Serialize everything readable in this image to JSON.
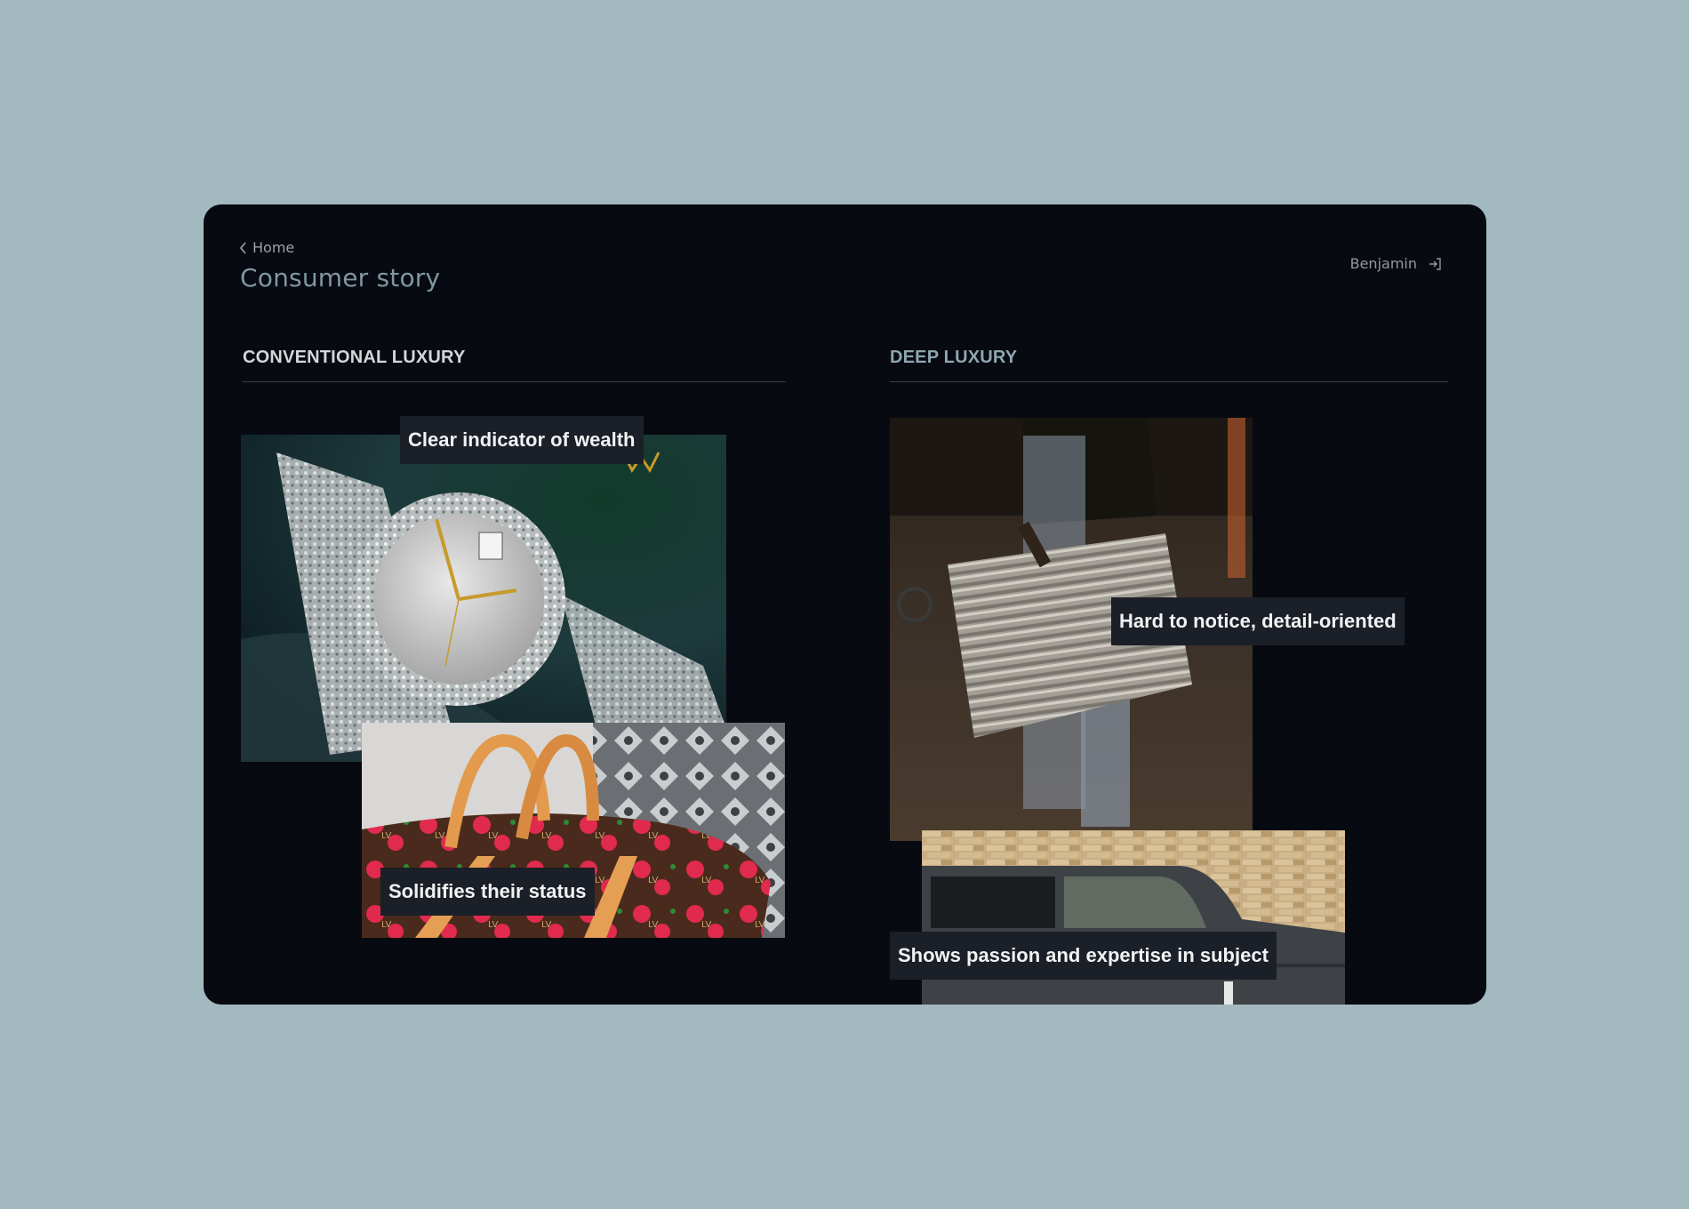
{
  "nav": {
    "back_label": "Home"
  },
  "page": {
    "title": "Consumer story"
  },
  "user": {
    "name": "Benjamin"
  },
  "sections": [
    {
      "heading": "CONVENTIONAL LUXURY",
      "cards": [
        {
          "image": "diamond-watch-photo",
          "caption": "Clear indicator of wealth"
        },
        {
          "image": "monogram-bag-photo",
          "caption": "Solidifies their status"
        }
      ]
    },
    {
      "heading": "DEEP LUXURY",
      "cards": [
        {
          "image": "aluminium-suitcase-photo",
          "caption": "Hard to notice, detail-oriented"
        },
        {
          "image": "dark-suv-photo",
          "caption": "Shows passion and expertise in subject"
        }
      ]
    }
  ],
  "colors": {
    "background": "#a2b9c0",
    "panel": "#070a10",
    "title": "#7f97a0",
    "caption_bg": "#1b1f27"
  }
}
